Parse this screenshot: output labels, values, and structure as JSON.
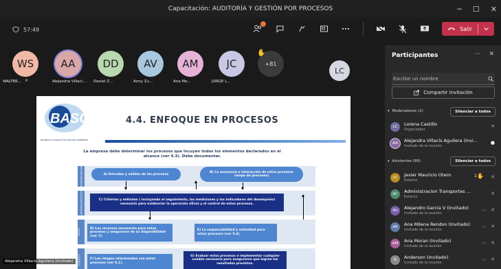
{
  "window": {
    "title": "Capacitación: AUDITORÍA Y GESTIÓN POR PROCESOS",
    "minimize": "─",
    "maximize": "☐",
    "close": "✕"
  },
  "toolbar": {
    "timer": "57:49",
    "leave_label": "Salir"
  },
  "stage": {
    "avatars": [
      {
        "initials": "WS",
        "name": "WALTER..."
      },
      {
        "initials": "AA",
        "name": "Alejandra Villací..."
      },
      {
        "initials": "DD",
        "name": "Daniel Z..."
      },
      {
        "initials": "AV",
        "name": "Anny Zu..."
      },
      {
        "initials": "AM",
        "name": "Ana Mo..."
      },
      {
        "initials": "JC",
        "name": "JORGE L..."
      }
    ],
    "more_count": "+81",
    "float_avatar": "LC",
    "presenter_caption": "Alejandra Villacís Aguilera (Invitado)"
  },
  "slide": {
    "logo_text": "BASC",
    "logo_sub": "BUSINESS ALLIANCE FOR SECURE COMMERCE",
    "title": "4.4. ENFOQUE EN PROCESOS",
    "cursor": "\\",
    "intro": "La empresa debe determinar los procesos que incuyen todos los elementos declarados en el alcance (ver 4.3). Debe documentar.",
    "bands": [
      "ENTRADAS/SALIDAS",
      "CRITERIOS/MÉTODOS",
      "APOYO",
      "CONTROL"
    ],
    "pill_a": "A) Entradas y salidas de los procesos",
    "pill_b": "B) La secuencia e interacción de estos procesos (mapa de procesos)",
    "box_c": "C) Criterios y métodos ( incluyendo el seguimiento, las mediciones y los indicadores del desempeño) necesario para evidenciar la operación eficaz y el control de estos procesos.",
    "box_d": "D) Los recursos necesarios para estos procesos y asegurarse de su disponibilidad (ver 7).",
    "box_e": "E) La responsabilidad y autoridad para estos procesos (ver 5.4).",
    "box_f": "F) Los riesgos relacionados con estos procesos (ver 6.1).",
    "box_g": "G) Evaluar estos procesos e implementar cualquier cambio necesario para asegurarse que logren los resultados previstos."
  },
  "panel": {
    "title": "Participantes",
    "search_placeholder": "Escribe un nombre",
    "share_label": "Compartir invitación",
    "moderators_header": "Moderadores (2)",
    "mute_all": "Silenciar a todos",
    "attendees_header": "Asistentes (86)",
    "moderators": [
      {
        "initials": "LC",
        "name": "Lorena Castillo",
        "role": "Organizador",
        "color": "#6f6f9f"
      },
      {
        "initials": "AA",
        "name": "Alejandra Villacís Aguilera (Invi...",
        "role": "Invitado de la reunión",
        "color": "#8c6aa8"
      }
    ],
    "attendees": [
      {
        "initials": "JO",
        "name": "Javier Mauricio Otero",
        "role": "Externo",
        "color": "#b68a1f",
        "badge": "1"
      },
      {
        "initials": "AC",
        "name": "Administracion Transportes ...",
        "role": "Externo",
        "color": "#4f8a6b"
      },
      {
        "initials": "AV",
        "name": "Alejandro Garcia V (Invitado)",
        "role": "Invitado de la reunión",
        "color": "#7a5fa8"
      },
      {
        "initials": "AR",
        "name": "Ana Milena Rendon (Invitado)",
        "role": "Invitado de la reunión",
        "color": "#5f79a8"
      },
      {
        "initials": "AM",
        "name": "Ana Moran (Invitado)",
        "role": "Invitado de la reunión",
        "color": "#a85f9a"
      },
      {
        "initials": "A",
        "name": "Anderson (Invitado)",
        "role": "Invitado de la reunión",
        "color": "#8a8a8a"
      }
    ]
  },
  "colors": {
    "leave": "#c4314b",
    "slide_blue": "#4f86d1",
    "slide_navy": "#1a2f86"
  }
}
